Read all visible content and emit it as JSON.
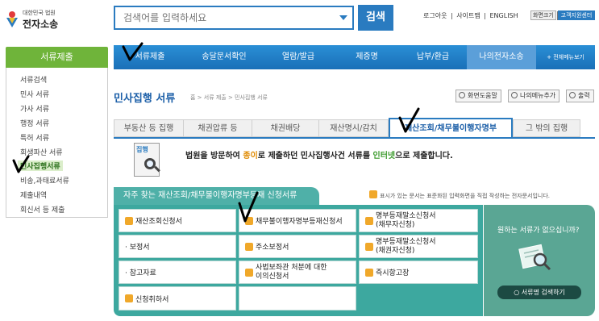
{
  "header": {
    "logo_sub": "대한민국 법원",
    "logo_main": "전자소송",
    "search_placeholder": "검색어를 입력하세요",
    "search_button": "검색",
    "util_links": [
      "로그아웃",
      "|",
      "사이트맵",
      "|",
      "ENGLISH"
    ],
    "zoom_label": "화면크기",
    "zoom_plus": "+",
    "zoom_minus": "−",
    "center_button": "고객지원센터"
  },
  "sidebar": {
    "title": "서류제출",
    "items": [
      "서류검색",
      "민사 서류",
      "가사 서류",
      "행정 서류",
      "특허 서류",
      "회생파산 서류",
      "민사집행서류",
      "비송,과태료서류",
      "제출내역",
      "회신서 등 제출"
    ],
    "active_index": 6
  },
  "nav": {
    "items": [
      "서류제출",
      "송달문서확인",
      "열람/발급",
      "제증명",
      "납부/환급",
      "나의전자소송"
    ],
    "active_index": 5,
    "all_menu": "+ 전체메뉴보기"
  },
  "page": {
    "title": "민사집행 서류",
    "breadcrumb": "홈 > 서류 제출 > 민사집행 서류",
    "tools": [
      "화면도움말",
      "나의메뉴추가",
      "출력"
    ]
  },
  "tabs": {
    "items": [
      "부동산 등 집행",
      "채권압류 등",
      "채권배당",
      "재산명시/감치",
      "재산조회/채무불이행자명부",
      "그 밖의 집행"
    ],
    "active_index": 4
  },
  "notice": {
    "icon_label": "집행",
    "text_a": "법원을 방문하여 ",
    "text_hl1": "종이",
    "text_b": "로 제출하던 민사집행사건 서류를 ",
    "text_hl2": "인터넷",
    "text_c": "으로 제출합니다."
  },
  "frequent": {
    "title": "자주 찾는 재산조회/채무불이행자명부등재 신청서류",
    "note": "표시가 있는 문서는 표준화된 입력화면을 직접 작성하는 전자문서입니다.",
    "items": [
      {
        "label": "재산조회신청서",
        "badge": true
      },
      {
        "label": "채무불이행자명부등재신청서",
        "badge": true
      },
      {
        "label": "명부등재말소신청서\n(채무자신청)",
        "badge": true
      },
      {
        "label": "· 보정서",
        "badge": false
      },
      {
        "label": "주소보정서",
        "badge": true
      },
      {
        "label": "명부등재말소신청서\n(채권자신청)",
        "badge": true
      },
      {
        "label": "· 참고자료",
        "badge": false
      },
      {
        "label": "사법보좌관 처분에 대한\n이의신청서",
        "badge": true
      },
      {
        "label": "즉시항고장",
        "badge": true
      },
      {
        "label": "신청취하서",
        "badge": true
      }
    ]
  },
  "help": {
    "question": "원하는 서류가 없으십니까?",
    "button": "서류명 검색하기"
  },
  "colors": {
    "primary_blue": "#2a7bc0",
    "sidebar_green": "#6fb43a",
    "panel_teal": "#3da89f",
    "badge_orange": "#f0a82a"
  }
}
